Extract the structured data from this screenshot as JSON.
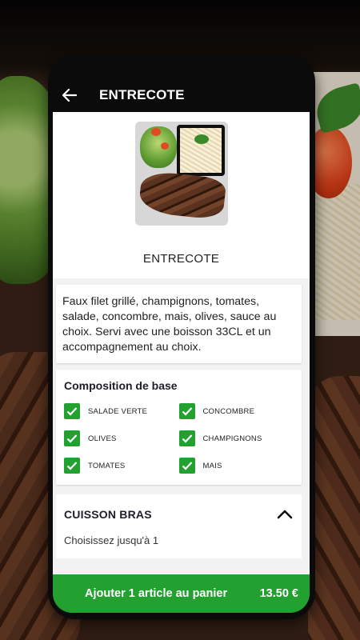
{
  "appbar": {
    "title": "ENTRECOTE",
    "back_icon": "arrow-left-icon"
  },
  "product": {
    "name": "ENTRECOTE",
    "description": "Faux filet grillé, champignons, tomates, salade, concombre, mais, olives, sauce au choix.  Servi avec une boisson 33CL et un accompagnement au choix."
  },
  "composition": {
    "title": "Composition de base",
    "items": [
      {
        "label": "SALADE VERTE",
        "checked": true
      },
      {
        "label": "CONCOMBRE",
        "checked": true
      },
      {
        "label": "OLIVES",
        "checked": true
      },
      {
        "label": "CHAMPIGNONS",
        "checked": true
      },
      {
        "label": "TOMATES",
        "checked": true
      },
      {
        "label": "MAIS",
        "checked": true
      }
    ]
  },
  "cuisson": {
    "title": "CUISSON BRAS",
    "subtitle": "Choisissez jusqu'à 1",
    "icon": "chevron-up-icon"
  },
  "cart": {
    "label": "Ajouter 1 article au panier",
    "price": "13.50 €"
  },
  "colors": {
    "accent": "#22a131",
    "appbar": "#0b0b0b"
  }
}
